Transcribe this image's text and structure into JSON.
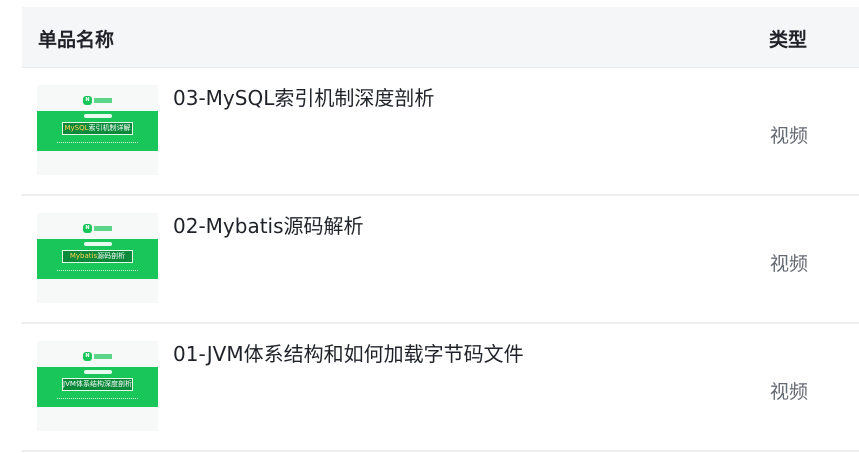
{
  "table": {
    "headers": {
      "name": "单品名称",
      "type": "类型"
    },
    "rows": [
      {
        "title": "03-MySQL索引机制深度剖析",
        "type": "视频",
        "thumbnail_text_a": "MySQL",
        "thumbnail_text_b": "索引机制详解"
      },
      {
        "title": "02-Mybatis源码解析",
        "type": "视频",
        "thumbnail_text_a": "Mybatis",
        "thumbnail_text_b": "源码剖析"
      },
      {
        "title": "01-JVM体系结构和如何加载字节码文件",
        "type": "视频",
        "thumbnail_text_a": "",
        "thumbnail_text_b": "JVM体系结构深度剖析"
      }
    ]
  },
  "colors": {
    "brand_green": "#19c65a",
    "header_bg": "#f5f6f7",
    "text_primary": "#1f2329",
    "text_secondary": "#646a73"
  },
  "icons": {
    "thumbnail_logo": "nc-logo-icon"
  }
}
